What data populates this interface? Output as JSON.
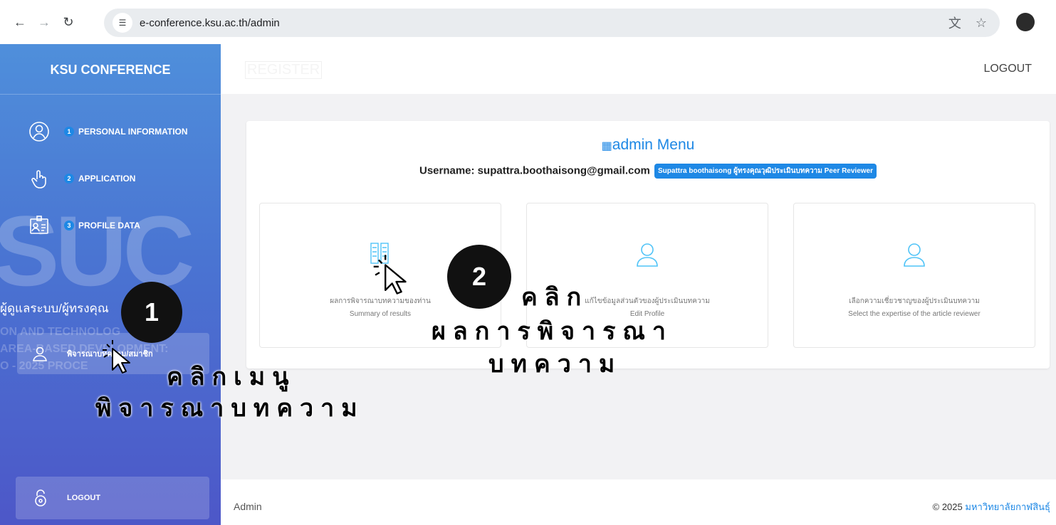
{
  "browser": {
    "url": "e-conference.ksu.ac.th/admin",
    "back_icon": "arrow-left-icon",
    "forward_icon": "arrow-right-icon",
    "reload_icon": "reload-icon"
  },
  "sidebar": {
    "title": "KSU CONFERENCE",
    "items": [
      {
        "num": "1",
        "label": "PERSONAL INFORMATION",
        "icon": "user-circle-icon"
      },
      {
        "num": "2",
        "label": "APPLICATION",
        "icon": "pointer-hand-icon"
      },
      {
        "num": "3",
        "label": "PROFILE DATA",
        "icon": "id-card-icon"
      }
    ],
    "section_label": "ผู้ดูแลระบบ/ผู้ทรงคุณ",
    "watermark_line1": "ON AND TECHNOLOG",
    "watermark_line2": "AREA-BASED DEVELOPMENT:",
    "watermark_line3": "O - 2025 PROCE",
    "active_item": {
      "label": "พิจารณาบทความ/สมาชิก",
      "icon": "user-icon"
    },
    "logout": "LOGOUT"
  },
  "topbar": {
    "register": "REGISTER",
    "logout": "LOGOUT"
  },
  "panel": {
    "title": "admin Menu",
    "username_label": "Username: supattra.boothaisong@gmail.com",
    "badge": "Supattra boothaisong ผู้ทรงคุณวุฒิประเมินบทความ Peer Reviewer",
    "cards": [
      {
        "th": "ผลการพิจารณาบทความของท่าน",
        "en": "Summary of results",
        "icon": "document-list-icon"
      },
      {
        "th": "แก้ไขข้อมูลส่วนตัวของผู้ประเมินบทความ",
        "en": "Edit Profile",
        "icon": "user-icon"
      },
      {
        "th": "เลือกความเชี่ยวชาญของผู้ประเมินบทความ",
        "en": "Select the expertise of the article reviewer",
        "icon": "user-icon"
      }
    ]
  },
  "footer": {
    "left": "Admin",
    "copyright": "© 2025",
    "university": "มหาวิทยาลัยกาฬสินธุ์"
  },
  "annotations": {
    "step1_num": "1",
    "step1_line1": "คลิกเมนู",
    "step1_line2": "พิจารณาบทความ",
    "step2_num": "2",
    "step2_line1": "คลิก",
    "step2_line2": "ผลการพิจารณา",
    "step2_line3": "บทความ"
  }
}
